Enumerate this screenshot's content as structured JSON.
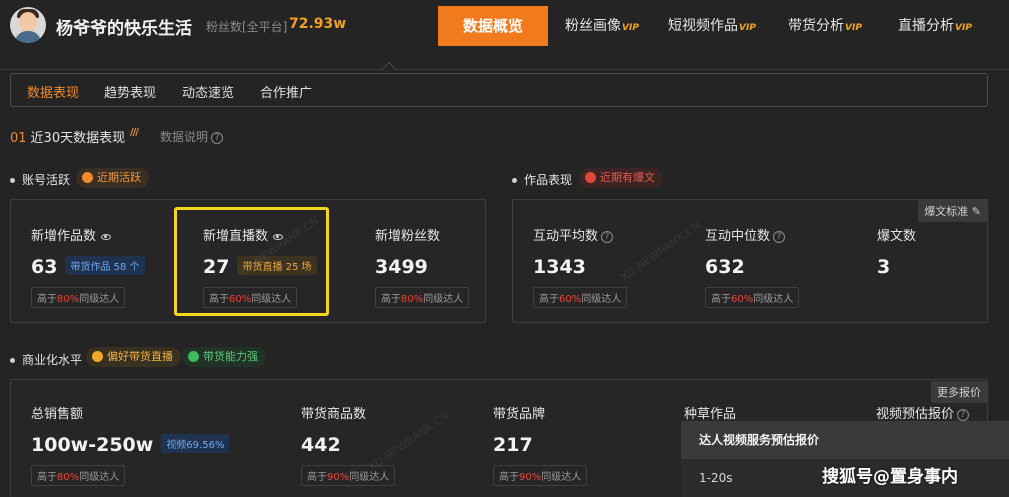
{
  "account": {
    "name": "杨爷爷的快乐生活",
    "fans_label": "粉丝数[全平台]",
    "fans_value": "72.93w"
  },
  "nav": [
    {
      "label": "数据概览",
      "vip": "",
      "active": true
    },
    {
      "label": "粉丝画像",
      "vip": "VIP",
      "active": false
    },
    {
      "label": "短视频作品",
      "vip": "VIP",
      "active": false
    },
    {
      "label": "带货分析",
      "vip": "VIP",
      "active": false
    },
    {
      "label": "直播分析",
      "vip": "VIP",
      "active": false
    }
  ],
  "subtabs": [
    {
      "label": "数据表现",
      "active": true
    },
    {
      "label": "趋势表现",
      "active": false
    },
    {
      "label": "动态速览",
      "active": false
    },
    {
      "label": "合作推广",
      "active": false
    }
  ],
  "section": {
    "num": "01",
    "title": "近30天数据表现",
    "help": "数据说明"
  },
  "account_activity": {
    "label": "账号活跃",
    "tag": "近期活跃",
    "metrics": [
      {
        "label": "新增作品数",
        "value": "63",
        "badge": "带货作品 58 个",
        "compare_prefix": "高于",
        "compare_pct": "80%",
        "compare_suffix": "同级达人"
      },
      {
        "label": "新增直播数",
        "value": "27",
        "badge": "带货直播 25 场",
        "compare_prefix": "高于",
        "compare_pct": "60%",
        "compare_suffix": "同级达人"
      },
      {
        "label": "新增粉丝数",
        "value": "3499",
        "badge": "",
        "compare_prefix": "高于",
        "compare_pct": "80%",
        "compare_suffix": "同级达人"
      }
    ]
  },
  "works": {
    "label": "作品表现",
    "tag": "近期有爆文",
    "button": "爆文标准",
    "metrics": [
      {
        "label": "互动平均数",
        "value": "1343",
        "compare_prefix": "高于",
        "compare_pct": "60%",
        "compare_suffix": "同级达人"
      },
      {
        "label": "互动中位数",
        "value": "632",
        "compare_prefix": "高于",
        "compare_pct": "60%",
        "compare_suffix": "同级达人"
      },
      {
        "label": "爆文数",
        "value": "3"
      }
    ]
  },
  "commercial": {
    "label": "商业化水平",
    "tags": [
      "偏好带货直播",
      "带货能力强"
    ],
    "button": "更多报价",
    "metrics": [
      {
        "label": "总销售额",
        "value": "100w-250w",
        "badge": "视频69.56%",
        "compare_prefix": "高于",
        "compare_pct": "80%",
        "compare_suffix": "同级达人"
      },
      {
        "label": "带货商品数",
        "value": "442",
        "compare_prefix": "高于",
        "compare_pct": "90%",
        "compare_suffix": "同级达人"
      },
      {
        "label": "带货品牌",
        "value": "217",
        "compare_prefix": "高于",
        "compare_pct": "90%",
        "compare_suffix": "同级达人"
      },
      {
        "label": "种草作品"
      },
      {
        "label": "视频预估报价"
      }
    ]
  },
  "popup": {
    "title": "达人视频服务预估报价",
    "row": "1-20s"
  },
  "source_watermark": "搜狐号@置身事内",
  "colors": {
    "accent": "#f07a1c",
    "highlight_box": "#f5d61e",
    "compare_red": "#e8443a"
  }
}
